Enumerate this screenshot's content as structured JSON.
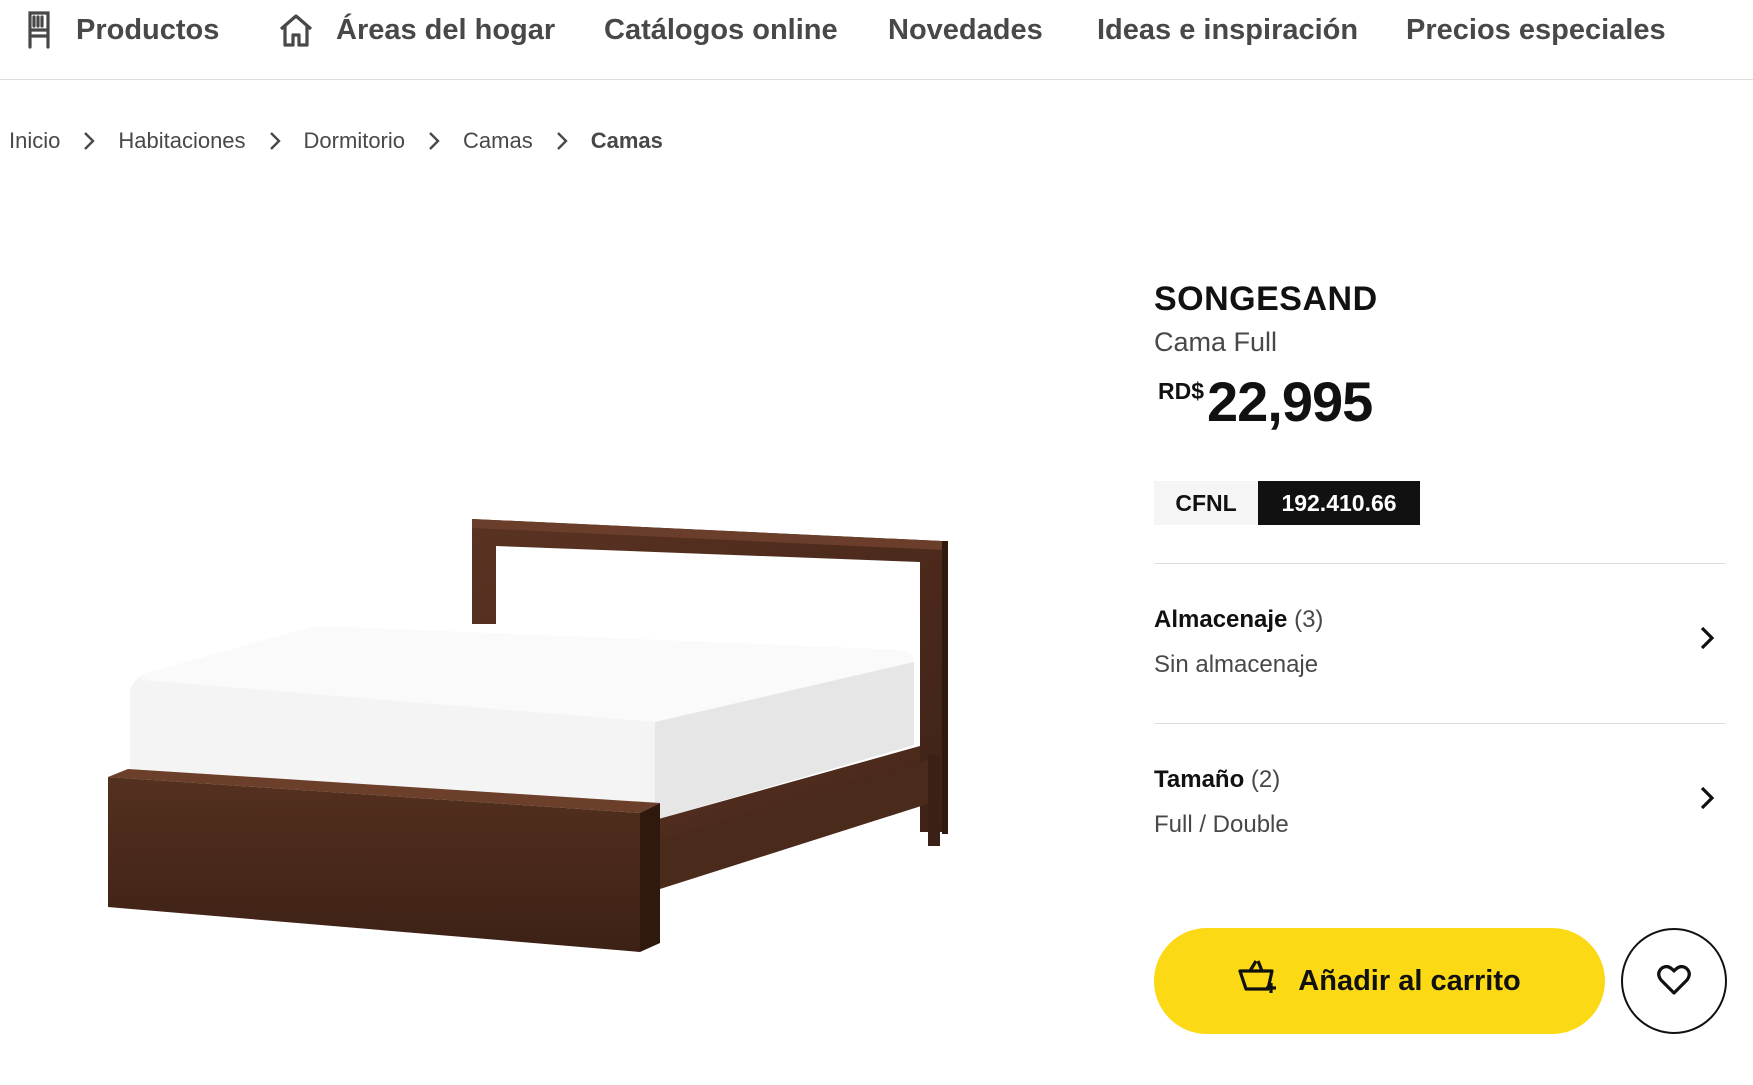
{
  "topnav": {
    "items": [
      {
        "label": "Productos",
        "icon": "chair-icon"
      },
      {
        "label": "Áreas del hogar",
        "icon": "home-icon"
      },
      {
        "label": "Catálogos online"
      },
      {
        "label": "Novedades"
      },
      {
        "label": "Ideas e inspiración"
      },
      {
        "label": "Precios especiales"
      }
    ]
  },
  "breadcrumb": [
    "Inicio",
    "Habitaciones",
    "Dormitorio",
    "Camas",
    "Camas"
  ],
  "product": {
    "name": "SONGESAND",
    "description": "Cama Full",
    "currency": "RD$",
    "price": "22,995",
    "tag_label": "CFNL",
    "tag_value": "192.410.66",
    "image_icon": "bed-frame-image"
  },
  "options": [
    {
      "title": "Almacenaje",
      "count": "(3)",
      "value": "Sin almacenaje"
    },
    {
      "title": "Tamaño",
      "count": "(2)",
      "value": "Full / Double"
    }
  ],
  "actions": {
    "add_to_cart": "Añadir al carrito",
    "cart_color": "#fbd914"
  }
}
